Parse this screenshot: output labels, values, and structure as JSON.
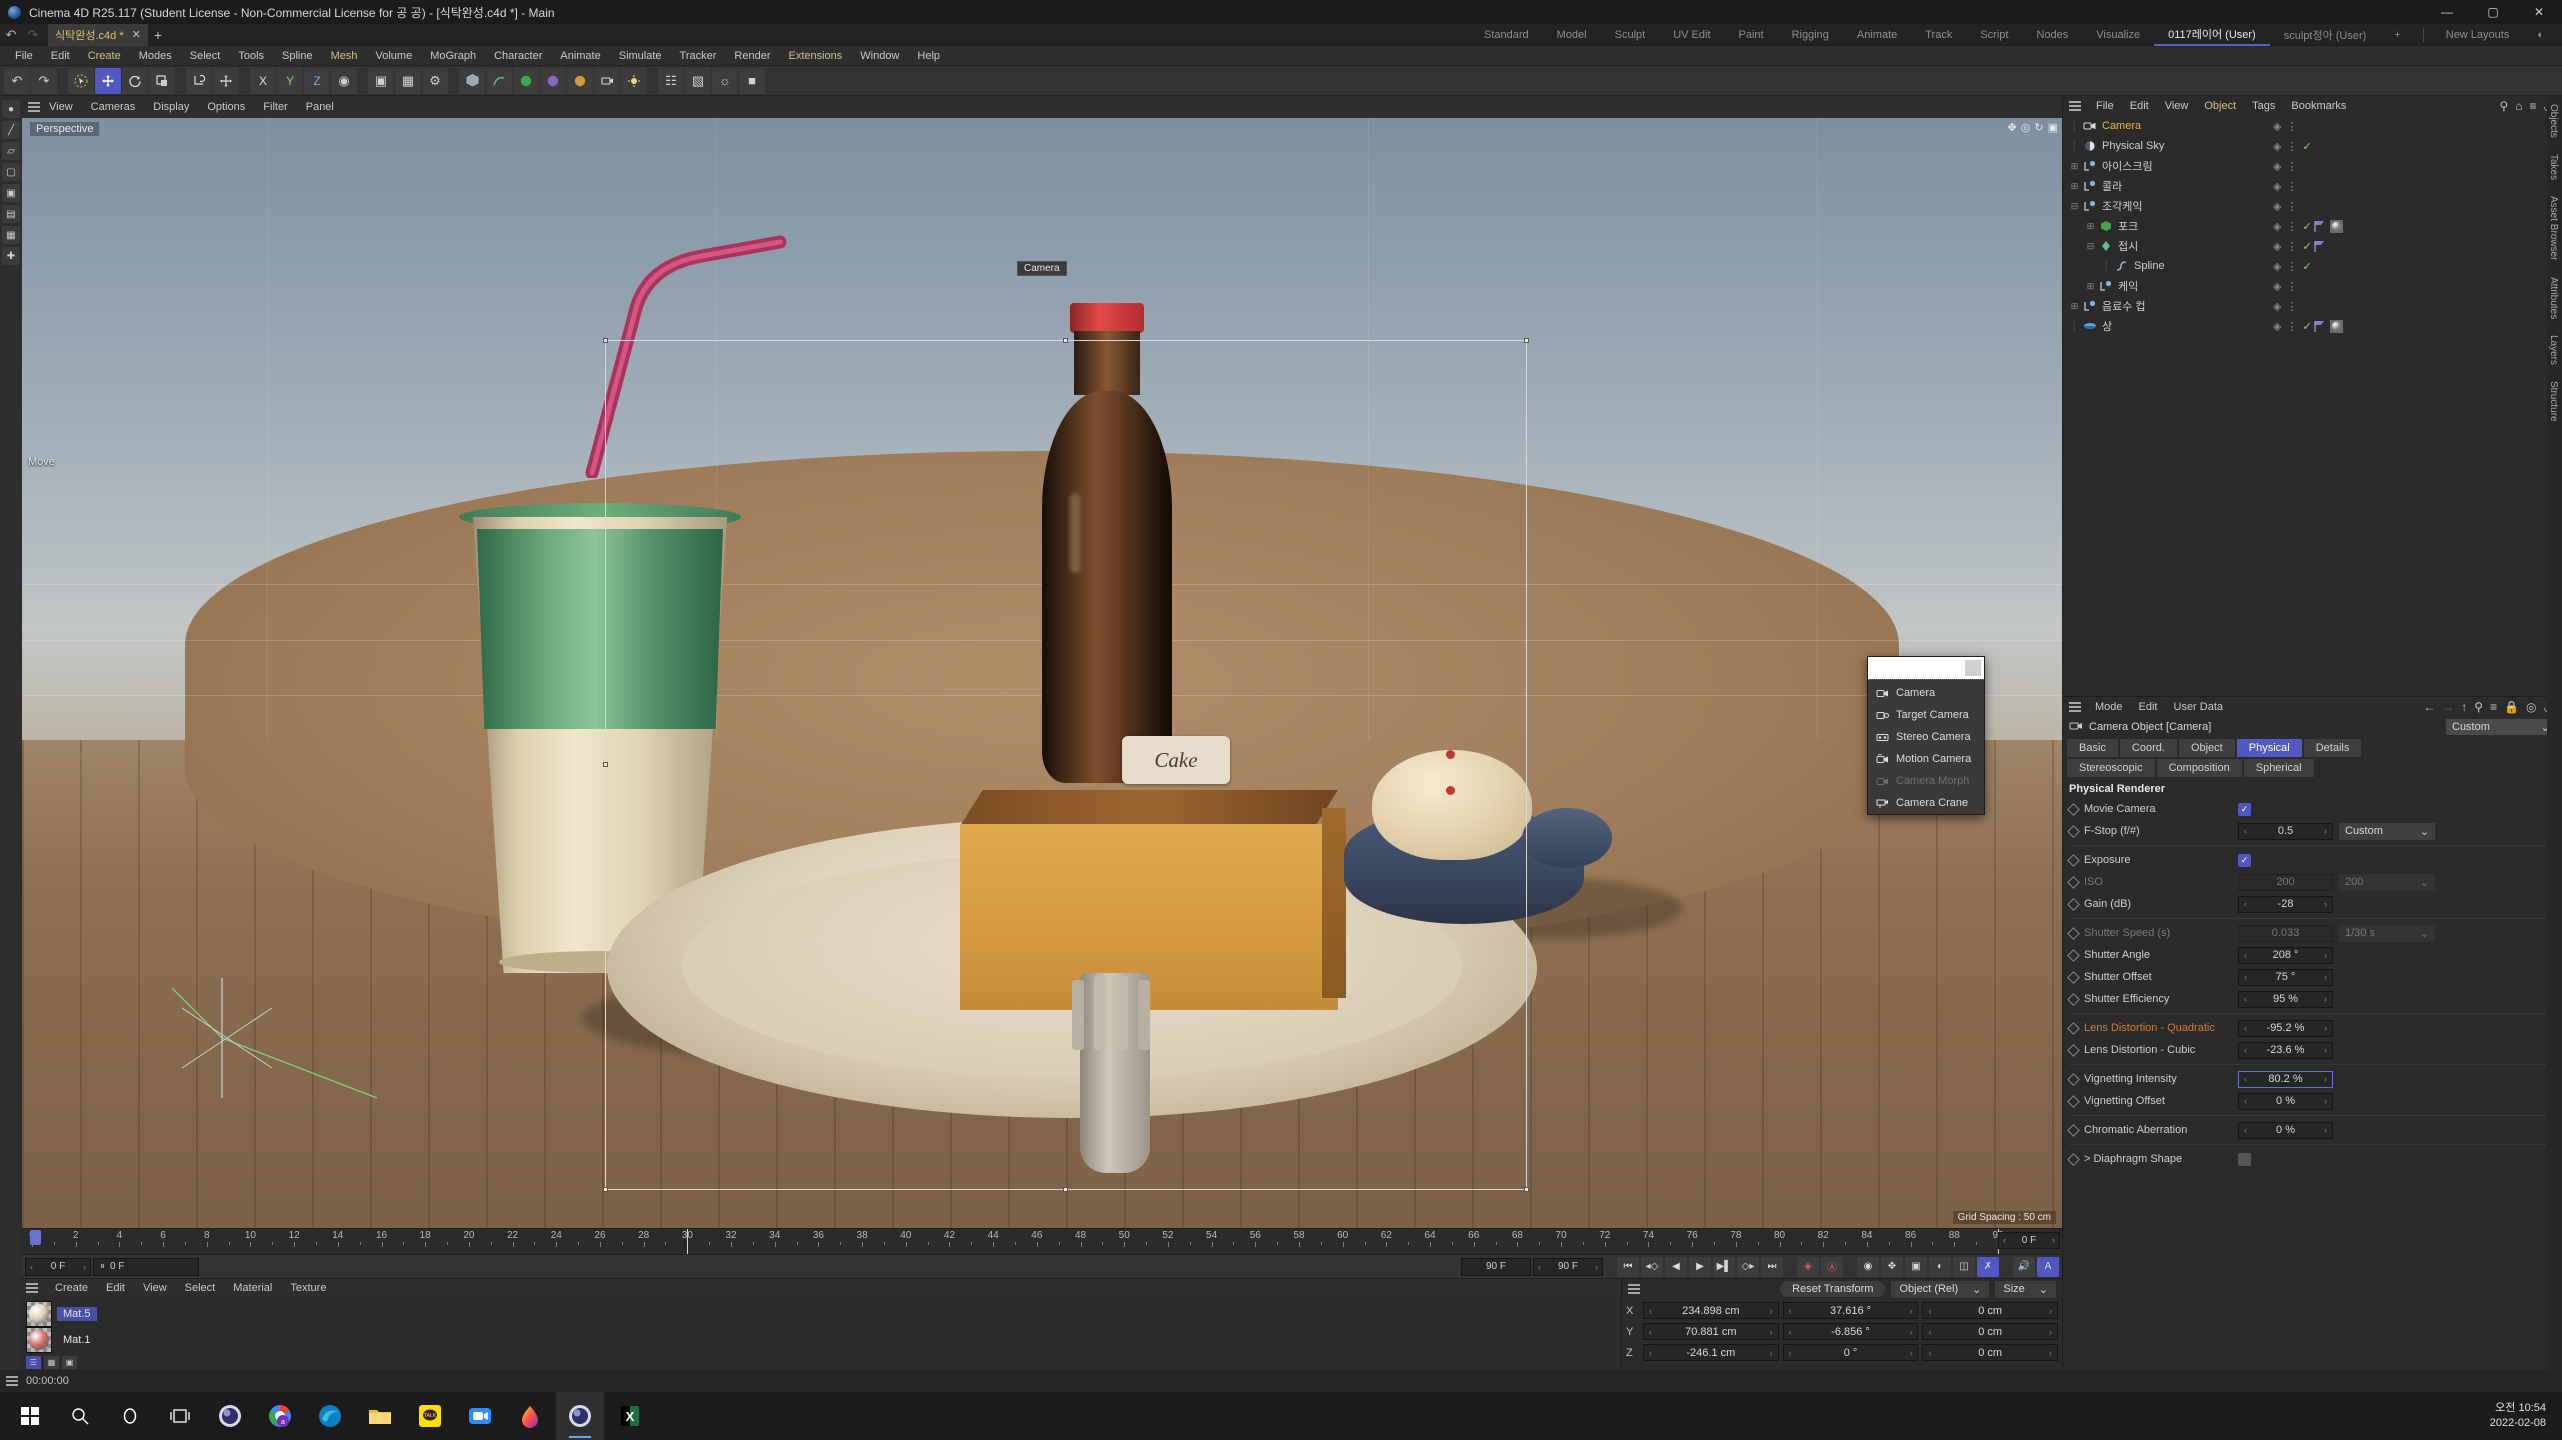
{
  "window": {
    "title": "Cinema 4D R25.117 (Student License - Non-Commercial License for 공 공) - [식탁완성.c4d *] - Main",
    "minimize": "—",
    "maximize": "▢",
    "close": "✕"
  },
  "doc_tab": {
    "label": "식탁완성.c4d *",
    "close": "✕",
    "new": "+"
  },
  "layouts": {
    "tabs": [
      "Standard",
      "Model",
      "Sculpt",
      "UV Edit",
      "Paint",
      "Rigging",
      "Animate",
      "Track",
      "Script",
      "Nodes",
      "Visualize",
      "0117레이어 (User)",
      "sculpt정아 (User)"
    ],
    "active": "0117레이어 (User)",
    "plus": "+",
    "new_layouts": "New Layouts"
  },
  "menubar": [
    "File",
    "Edit",
    "Create",
    "Modes",
    "Select",
    "Tools",
    "Spline",
    "Mesh",
    "Volume",
    "MoGraph",
    "Character",
    "Animate",
    "Simulate",
    "Tracker",
    "Render",
    "Extensions",
    "Window",
    "Help"
  ],
  "menubar_highlight": [
    "Create",
    "Mesh",
    "Extensions"
  ],
  "viewport": {
    "menu": [
      "View",
      "Cameras",
      "Display",
      "Options",
      "Filter",
      "Panel"
    ],
    "label": "Perspective",
    "camera_label": "Camera",
    "move_label": "Move",
    "grid_info": "Grid Spacing : 50 cm",
    "cake_text": "Cake"
  },
  "camera_menu": {
    "items": [
      {
        "label": "Camera",
        "icon": "camera-icon",
        "disabled": false
      },
      {
        "label": "Target Camera",
        "icon": "target-camera-icon",
        "disabled": false
      },
      {
        "label": "Stereo Camera",
        "icon": "stereo-camera-icon",
        "disabled": false
      },
      {
        "label": "Motion Camera",
        "icon": "motion-camera-icon",
        "disabled": false
      },
      {
        "label": "Camera Morph",
        "icon": "camera-morph-icon",
        "disabled": true
      },
      {
        "label": "Camera Crane",
        "icon": "camera-crane-icon",
        "disabled": false
      }
    ]
  },
  "timeline": {
    "start": 0,
    "end": 90,
    "step": 2,
    "current_frame": "0 F",
    "playhead_frame": "0 F",
    "end_field_a": "90 F",
    "end_field_b": "90 F",
    "right_field": "0 F"
  },
  "object_manager": {
    "menu": [
      "File",
      "Edit",
      "View",
      "Object",
      "Tags",
      "Bookmarks"
    ],
    "menu_highlight": "Object",
    "icons": [
      "search-icon",
      "home-icon",
      "filter-icon",
      "popout-icon"
    ],
    "side_tabs": [
      "Objects",
      "Takes",
      "Asset Browser"
    ],
    "items": [
      {
        "name": "Camera",
        "depth": 0,
        "expander": "",
        "icon": "camera-icon",
        "selected": true,
        "check": false,
        "tags": []
      },
      {
        "name": "Physical Sky",
        "depth": 0,
        "expander": "",
        "icon": "sky-icon",
        "selected": false,
        "check": true,
        "tags": []
      },
      {
        "name": "아이스크림",
        "depth": 0,
        "expander": "+",
        "icon": "null-icon",
        "selected": false,
        "check": false,
        "tags": []
      },
      {
        "name": "콜라",
        "depth": 0,
        "expander": "+",
        "icon": "null-icon",
        "selected": false,
        "check": false,
        "tags": []
      },
      {
        "name": "조각케익",
        "depth": 0,
        "expander": "-",
        "icon": "null-icon",
        "selected": false,
        "check": false,
        "tags": []
      },
      {
        "name": "포크",
        "depth": 1,
        "expander": "+",
        "icon": "cube-icon",
        "selected": false,
        "check": true,
        "tags": [
          "flag",
          "material"
        ]
      },
      {
        "name": "접시",
        "depth": 1,
        "expander": "-",
        "icon": "lathe-icon",
        "selected": false,
        "check": true,
        "tags": [
          "flag"
        ]
      },
      {
        "name": "Spline",
        "depth": 2,
        "expander": "",
        "icon": "spline-icon",
        "selected": false,
        "check": true,
        "tags": []
      },
      {
        "name": "케익",
        "depth": 1,
        "expander": "+",
        "icon": "null-icon",
        "selected": false,
        "check": false,
        "tags": []
      },
      {
        "name": "음료수 컵",
        "depth": 0,
        "expander": "+",
        "icon": "null-icon",
        "selected": false,
        "check": false,
        "tags": []
      },
      {
        "name": "상",
        "depth": 0,
        "expander": "",
        "icon": "disc-icon",
        "selected": false,
        "check": true,
        "tags": [
          "flag",
          "material"
        ]
      }
    ]
  },
  "attributes": {
    "menu": [
      "Mode",
      "Edit",
      "User Data"
    ],
    "icons": [
      "back-icon",
      "forward-icon",
      "up-icon",
      "search-icon",
      "filter-icon",
      "lock-icon",
      "target-icon",
      "popout-icon"
    ],
    "object_title": "Camera Object [Camera]",
    "preset": "Custom",
    "tabs_row1": [
      "Basic",
      "Coord.",
      "Object",
      "Physical",
      "Details"
    ],
    "tabs_row2": [
      "Stereoscopic",
      "Composition",
      "Spherical"
    ],
    "active_tab": "Physical",
    "section": "Physical Renderer",
    "side_tabs": [
      "Attributes",
      "Layers",
      "Structure"
    ],
    "rows": [
      {
        "label": "Movie Camera",
        "type": "check",
        "value": true,
        "dim": false
      },
      {
        "label": "F-Stop (f/#)",
        "type": "num-drop",
        "value": "0.5",
        "drop": "Custom",
        "dim": false
      },
      {
        "divider": true
      },
      {
        "label": "Exposure",
        "type": "check",
        "value": true,
        "dim": false
      },
      {
        "label": "ISO",
        "type": "num-drop",
        "value": "200",
        "drop": "200",
        "dim": true
      },
      {
        "label": "Gain (dB)",
        "type": "num",
        "value": "-28",
        "dim": false
      },
      {
        "divider": true
      },
      {
        "label": "Shutter Speed (s)",
        "type": "num-drop",
        "value": "0.033",
        "drop": "1/30 s",
        "dim": true
      },
      {
        "label": "Shutter Angle",
        "type": "num",
        "value": "208 °",
        "dim": false
      },
      {
        "label": "Shutter Offset",
        "type": "num",
        "value": "75 °",
        "dim": false
      },
      {
        "label": "Shutter Efficiency",
        "type": "num",
        "value": "95 %",
        "dim": false
      },
      {
        "divider": true
      },
      {
        "label": "Lens Distortion - Quadratic",
        "type": "num",
        "value": "-95.2 %",
        "dim": false,
        "warn": true
      },
      {
        "label": "Lens Distortion - Cubic",
        "type": "num",
        "value": "-23.6 %",
        "dim": false
      },
      {
        "divider": true
      },
      {
        "label": "Vignetting Intensity",
        "type": "num",
        "value": "80.2 %",
        "dim": false,
        "highlight": true
      },
      {
        "label": "Vignetting Offset",
        "type": "num",
        "value": "0 %",
        "dim": false
      },
      {
        "divider": true
      },
      {
        "label": "Chromatic Aberration",
        "type": "num",
        "value": "0 %",
        "dim": false
      },
      {
        "divider": true
      },
      {
        "label": "Diaphragm Shape",
        "type": "box",
        "value": false,
        "dim": false,
        "expander": ">"
      }
    ]
  },
  "material_manager": {
    "menu": [
      "Create",
      "Edit",
      "View",
      "Select",
      "Material",
      "Texture"
    ],
    "materials": [
      {
        "name": "Mat.5",
        "color": "#e0d3b8",
        "selected": true
      },
      {
        "name": "Mat.1",
        "color": "#d4716e",
        "selected": false
      }
    ],
    "view_modes": [
      "list-view-icon",
      "grid-view-icon",
      "stack-view-icon"
    ]
  },
  "coordinates": {
    "reset_label": "Reset Transform",
    "mode": "Object (Rel)",
    "size_label": "Size",
    "rows": [
      {
        "axis": "X",
        "position": "234.898 cm",
        "rotation": "37.616 °",
        "size": "0 cm"
      },
      {
        "axis": "Y",
        "position": "70.881 cm",
        "rotation": "-6.856 °",
        "size": "0 cm"
      },
      {
        "axis": "Z",
        "position": "-246.1 cm",
        "rotation": "0 °",
        "size": "0 cm"
      }
    ]
  },
  "statusbar": {
    "time": "00:00:00"
  },
  "taskbar": {
    "items": [
      "start-icon",
      "search-icon",
      "cortana-icon",
      "task-view-icon",
      "cinema4d-icon",
      "chrome-icon",
      "edge-icon",
      "explorer-icon",
      "kakaotalk-icon",
      "zoom-icon",
      "paint3d-icon",
      "cinema4d-active-icon",
      "excel-icon"
    ],
    "clock_time": "오전 10:54",
    "clock_date": "2022-02-08"
  },
  "colors": {
    "accent": "#5357c4",
    "selected_text": "#e3b34a",
    "warn_text": "#d2793a",
    "panel_bg": "#2b2b2b"
  }
}
